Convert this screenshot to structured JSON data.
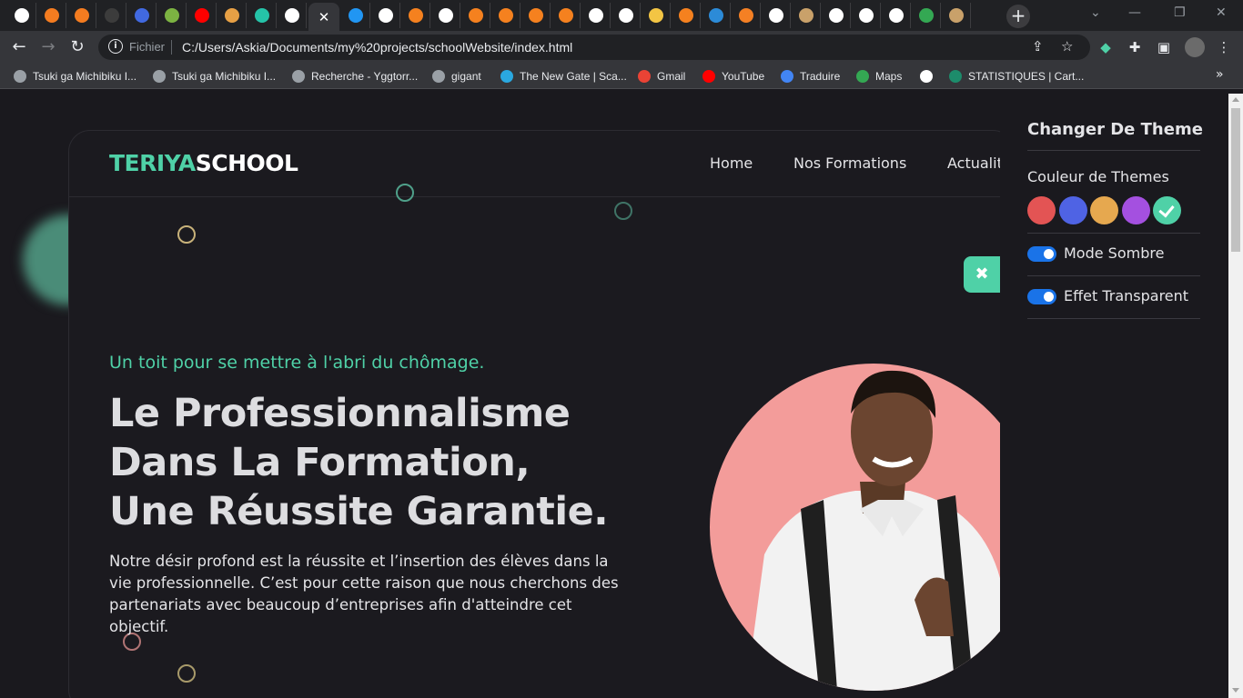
{
  "browser": {
    "tabs": [
      {
        "icon": "google-icon",
        "color": "#ffffff"
      },
      {
        "icon": "xampp-icon",
        "color": "#f47c20"
      },
      {
        "icon": "xampp-icon",
        "color": "#f47c20"
      },
      {
        "icon": "bootstrap-icon",
        "color": "#3c3c3c"
      },
      {
        "icon": "g-icon",
        "color": "#4169e1"
      },
      {
        "icon": "leaf-icon",
        "color": "#7cb342"
      },
      {
        "icon": "youtube-icon",
        "color": "#ff0000"
      },
      {
        "icon": "app-icon",
        "color": "#e7a045"
      },
      {
        "icon": "app-icon",
        "color": "#25c3a8"
      },
      {
        "icon": "globe-icon",
        "color": "#ffffff"
      },
      {
        "icon": "active-tab",
        "color": "#35363a"
      },
      {
        "icon": "edge-icon",
        "color": "#2196f3"
      },
      {
        "icon": "google-icon",
        "color": "#ffffff"
      },
      {
        "icon": "box-icon",
        "color": "#f5811f"
      },
      {
        "icon": "globe-icon",
        "color": "#ffffff"
      },
      {
        "icon": "box-icon",
        "color": "#f5811f"
      },
      {
        "icon": "box-icon",
        "color": "#f5811f"
      },
      {
        "icon": "box-icon",
        "color": "#f5811f"
      },
      {
        "icon": "box-icon",
        "color": "#f5811f"
      },
      {
        "icon": "globe-icon",
        "color": "#ffffff"
      },
      {
        "icon": "globe-icon",
        "color": "#ffffff"
      },
      {
        "icon": "package-icon",
        "color": "#f3c544"
      },
      {
        "icon": "box-icon",
        "color": "#f5811f"
      },
      {
        "icon": "h-icon",
        "color": "#2c8bd8"
      },
      {
        "icon": "stack-icon",
        "color": "#f48024"
      },
      {
        "icon": "globe-icon",
        "color": "#ffffff"
      },
      {
        "icon": "hand-icon",
        "color": "#c9a16a"
      },
      {
        "icon": "globe-icon",
        "color": "#ffffff"
      },
      {
        "icon": "globe-icon",
        "color": "#ffffff"
      },
      {
        "icon": "globe-icon",
        "color": "#ffffff"
      },
      {
        "icon": "maps-icon",
        "color": "#34a853"
      },
      {
        "icon": "hand-icon",
        "color": "#c9a16a"
      }
    ],
    "active_tab_close": "✕",
    "new_tab": "+",
    "url_scheme": "Fichier",
    "url": "C:/Users/Askia/Documents/my%20projects/schoolWebsite/index.html",
    "bookmarks": [
      {
        "label": "Tsuki ga Michibiku I...",
        "color": "#9aa0a6"
      },
      {
        "label": "Tsuki ga Michibiku I...",
        "color": "#9aa0a6"
      },
      {
        "label": "Recherche - Yggtorr...",
        "color": "#9aa0a6"
      },
      {
        "label": "gigant",
        "color": "#9aa0a6"
      },
      {
        "label": "The New Gate | Sca...",
        "color": "#2aa8e0"
      },
      {
        "label": "Gmail",
        "color": "#ea4335"
      },
      {
        "label": "YouTube",
        "color": "#ff0000"
      },
      {
        "label": "Traduire",
        "color": "#4285f4"
      },
      {
        "label": "Maps",
        "color": "#34a853"
      },
      {
        "label": "",
        "color": "#ffffff"
      },
      {
        "label": "STATISTIQUES | Cart...",
        "color": "#1d8c6b"
      }
    ],
    "bookmarks_more": "»"
  },
  "site": {
    "logo_part1": "TERIYA",
    "logo_part2": "SCHOOL",
    "nav": [
      "Home",
      "Nos Formations",
      "Actualit"
    ],
    "tagline": "Un toit pour se mettre à l'abri du chômage.",
    "headline_lines": [
      "Le Professionnalisme",
      "Dans La Formation,",
      "Une Réussite Garantie."
    ],
    "description": "Notre désir profond est la réussite et l’insertion des élèves dans la vie professionnelle. C’est pour cette raison que nous cherchons des partenariats avec beaucoup d’entreprises afin d'atteindre cet objectif.",
    "accent_color": "#4fd1a7"
  },
  "theme_panel": {
    "title": "Changer De Theme",
    "colors_label": "Couleur de Themes",
    "swatches": [
      {
        "color": "#e35454",
        "selected": false
      },
      {
        "color": "#4f63e4",
        "selected": false
      },
      {
        "color": "#e6a84f",
        "selected": false
      },
      {
        "color": "#a450e0",
        "selected": false
      },
      {
        "color": "#4fd1a7",
        "selected": true
      }
    ],
    "dark_mode_label": "Mode Sombre",
    "dark_mode_on": true,
    "transparent_label": "Effet Transparent",
    "transparent_on": true,
    "close_symbol": "✖"
  }
}
